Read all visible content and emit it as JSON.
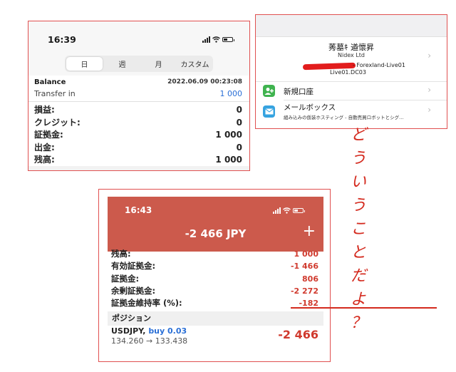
{
  "panel1": {
    "time": "16:39",
    "tabs": [
      {
        "label": "日",
        "active": true
      },
      {
        "label": "週",
        "active": false
      },
      {
        "label": "月",
        "active": false
      },
      {
        "label": "カスタム",
        "active": false
      }
    ],
    "balance_title": "Balance",
    "balance_date": "2022.06.09 00:23:08",
    "transfer_label": "Transfer in",
    "transfer_amount": "1 000",
    "rows": [
      {
        "label": "損益:",
        "value": "0"
      },
      {
        "label": "クレジット:",
        "value": "0"
      },
      {
        "label": "証拠金:",
        "value": "1 000"
      },
      {
        "label": "出金:",
        "value": "0"
      },
      {
        "label": "残高:",
        "value": "1 000"
      }
    ]
  },
  "panel2": {
    "account_name": "莠墓ｷ 遒懷昇",
    "company": "Nidex Ltd",
    "server_line1": "- Forexland-Live01",
    "server_line2": "Live01.DC03",
    "menu": [
      {
        "icon": "add-user-icon",
        "label": "新規口座",
        "sub": ""
      },
      {
        "icon": "mail-icon",
        "label": "メールボックス",
        "sub": "組み込みの仮装ホスティング - 自動売買ロボットとシグ…"
      }
    ],
    "colors": {
      "new_account_icon": "#3fb34f",
      "mail_icon": "#36a3e0"
    }
  },
  "panel3": {
    "time": "16:43",
    "equity": "-2 466 JPY",
    "plus_symbol": "+",
    "rows": [
      {
        "label": "残高:",
        "value": "1 000"
      },
      {
        "label": "有効証拠金:",
        "value": "-1 466"
      },
      {
        "label": "証拠金:",
        "value": "806"
      },
      {
        "label": "余剰証拠金:",
        "value": "-2 272"
      },
      {
        "label": "証拠金維持率 (%):",
        "value": "-182"
      }
    ],
    "positions_header": "ポジション",
    "position": {
      "symbol": "USDJPY,",
      "side": "buy 0.03",
      "prices": "134.260 → 133.438",
      "profit": "-2 466"
    },
    "colors": {
      "header": "#cc5a4c",
      "negative": "#d03a2e"
    }
  },
  "annotation": {
    "chars": [
      "ど",
      "う",
      "い",
      "う",
      "こ",
      "と",
      "だ",
      "よ",
      "？"
    ],
    "color": "#d42a1e"
  }
}
